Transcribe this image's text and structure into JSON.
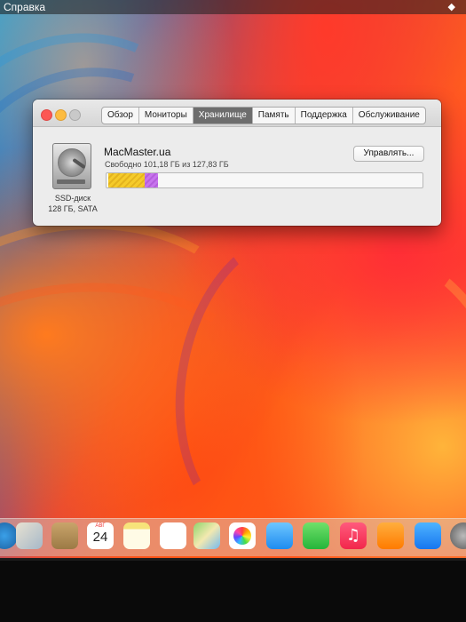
{
  "menubar": {
    "help_label": "Справка",
    "right_glyph": "◆"
  },
  "window": {
    "tabs": [
      {
        "label": "Обзор"
      },
      {
        "label": "Мониторы"
      },
      {
        "label": "Хранилище",
        "active": true
      },
      {
        "label": "Память"
      },
      {
        "label": "Поддержка"
      },
      {
        "label": "Обслуживание"
      }
    ],
    "storage": {
      "volume_name": "MacMaster.ua",
      "free_space_text": "Свободно 101,18 ГБ из 127,83 ГБ",
      "disk_type": "SSD-диск",
      "disk_spec": "128 ГБ, SATA",
      "manage_label": "Управлять...",
      "usage_segments": [
        {
          "name": "apps",
          "fraction": 0.115,
          "color": "#f5cb2a"
        },
        {
          "name": "other",
          "fraction": 0.042,
          "color": "#c874ee"
        }
      ]
    }
  },
  "dock": {
    "items": [
      {
        "name": "system-preferences-partial-icon"
      },
      {
        "name": "preview-icon"
      },
      {
        "name": "contacts-icon"
      },
      {
        "name": "calendar-icon",
        "month": "АВГ",
        "day": "24"
      },
      {
        "name": "notes-icon"
      },
      {
        "name": "reminders-icon"
      },
      {
        "name": "maps-icon"
      },
      {
        "name": "photos-icon"
      },
      {
        "name": "messages-icon"
      },
      {
        "name": "facetime-icon"
      },
      {
        "name": "music-icon"
      },
      {
        "name": "books-icon"
      },
      {
        "name": "app-store-icon"
      },
      {
        "name": "system-preferences-icon"
      }
    ]
  }
}
